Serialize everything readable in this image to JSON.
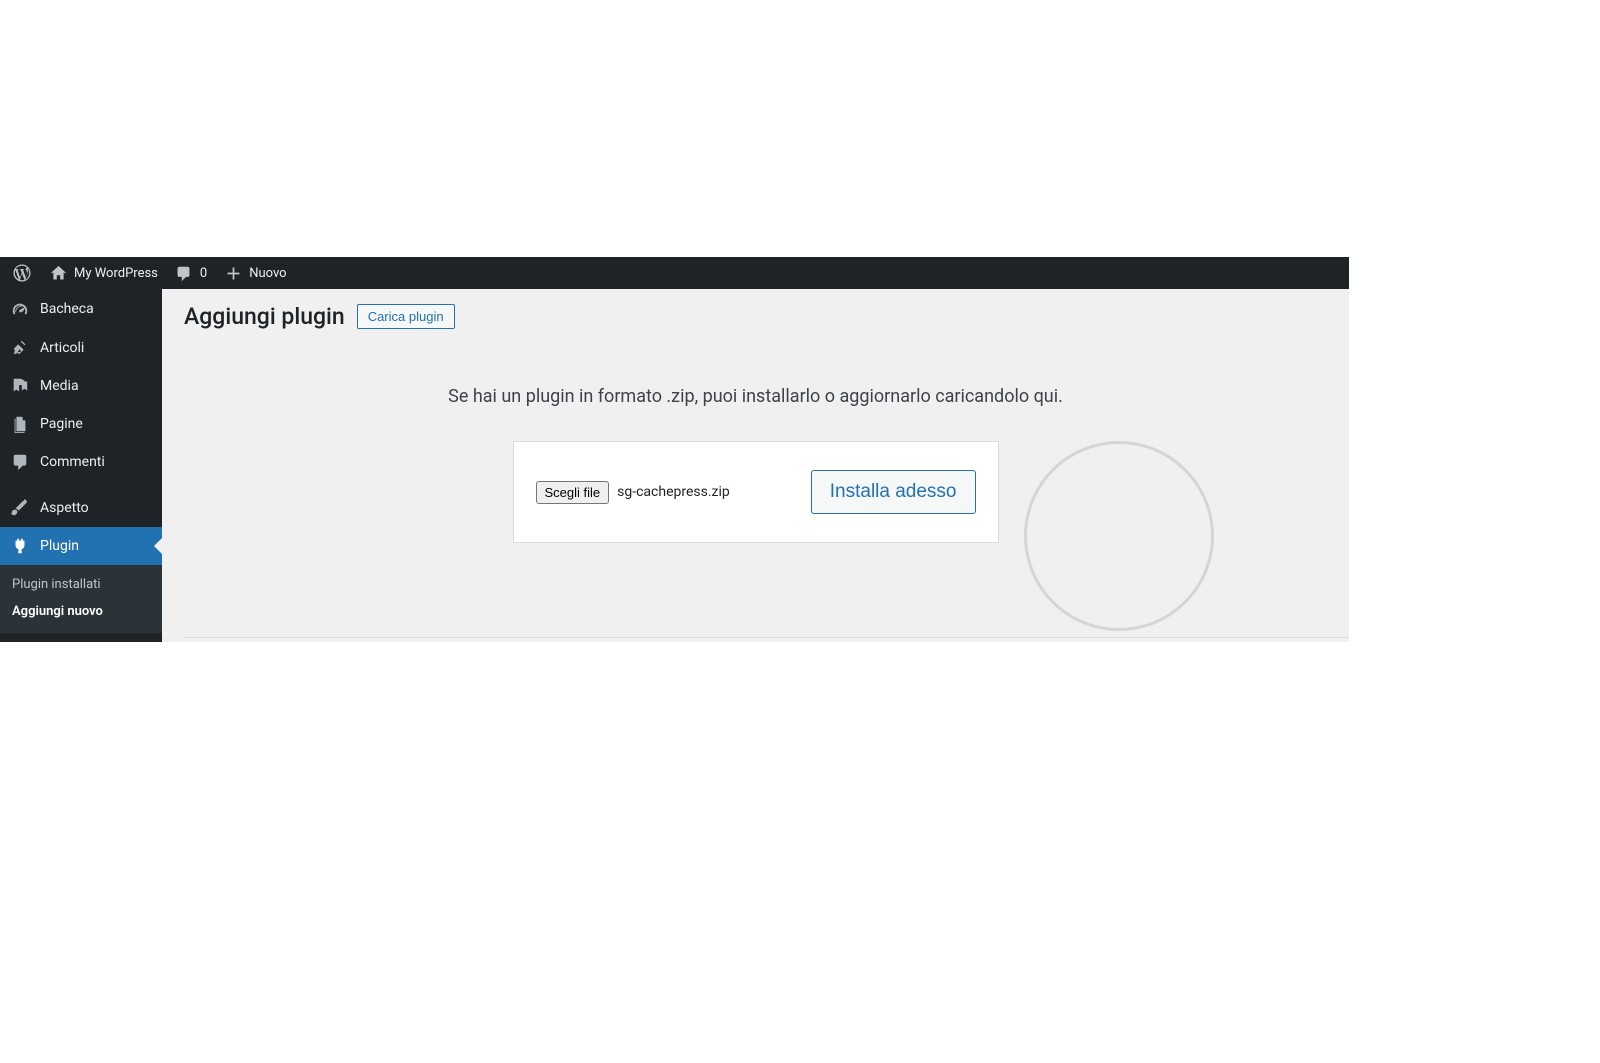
{
  "adminbar": {
    "site_name": "My WordPress",
    "comment_count": "0",
    "new_label": "Nuovo"
  },
  "sidebar": {
    "dashboard": "Bacheca",
    "posts": "Articoli",
    "media": "Media",
    "pages": "Pagine",
    "comments": "Commenti",
    "appearance": "Aspetto",
    "plugins": "Plugin",
    "submenu": {
      "installed": "Plugin installati",
      "add_new": "Aggiungi nuovo"
    }
  },
  "main": {
    "page_title": "Aggiungi plugin",
    "upload_toggle": "Carica plugin",
    "prompt": "Se hai un plugin in formato .zip, puoi installarlo o aggiornarlo caricandolo qui.",
    "choose_file": "Scegli file",
    "chosen_filename": "sg-cachepress.zip",
    "install_now": "Installa adesso"
  }
}
